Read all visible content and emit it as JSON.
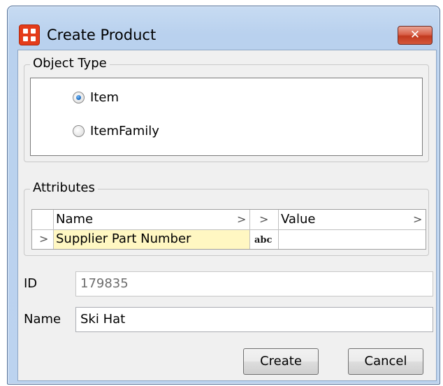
{
  "window": {
    "title": "Create Product",
    "close_label": "✕"
  },
  "object_type": {
    "legend": "Object Type",
    "options": [
      {
        "label": "Item",
        "checked": true
      },
      {
        "label": "ItemFamily",
        "checked": false
      }
    ]
  },
  "attributes": {
    "legend": "Attributes",
    "columns": {
      "name": "Name",
      "value": "Value"
    },
    "rows": [
      {
        "name": "Supplier Part Number",
        "type_badge": "abc",
        "value": ""
      }
    ]
  },
  "fields": {
    "id": {
      "label": "ID",
      "value": "179835"
    },
    "name": {
      "label": "Name",
      "value": "Ski Hat"
    }
  },
  "buttons": {
    "create": "Create",
    "cancel": "Cancel"
  },
  "icons": {
    "app": "app-grid-icon",
    "close": "close-icon",
    "row_expand": "chevron-right-icon"
  },
  "colors": {
    "accent": "#e43c1a",
    "highlight_row": "#fff7c2",
    "titlebar": "#c7dbf2"
  }
}
